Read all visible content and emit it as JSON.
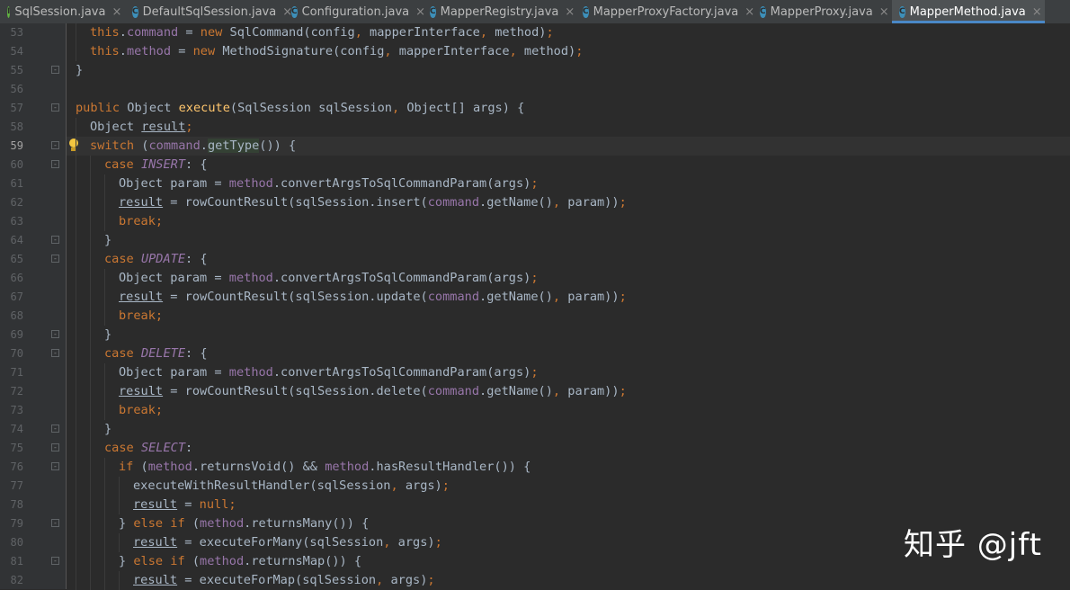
{
  "tabs": [
    {
      "name": "SqlSession.java",
      "icon": "I",
      "kind": "interface",
      "active": false
    },
    {
      "name": "DefaultSqlSession.java",
      "icon": "C",
      "kind": "class",
      "active": false
    },
    {
      "name": "Configuration.java",
      "icon": "C",
      "kind": "class",
      "active": false
    },
    {
      "name": "MapperRegistry.java",
      "icon": "C",
      "kind": "class",
      "active": false
    },
    {
      "name": "MapperProxyFactory.java",
      "icon": "C",
      "kind": "class",
      "active": false
    },
    {
      "name": "MapperProxy.java",
      "icon": "C",
      "kind": "class",
      "active": false
    },
    {
      "name": "MapperMethod.java",
      "icon": "C",
      "kind": "class",
      "active": true
    }
  ],
  "close_glyph": "×",
  "current_line": 59,
  "lines": [
    {
      "n": 53,
      "indent": 1,
      "tokens": [
        [
          "this",
          "kw"
        ],
        [
          ".",
          ""
        ],
        [
          "command",
          "fld"
        ],
        [
          " = ",
          ""
        ],
        [
          "new",
          "kw"
        ],
        [
          " SqlCommand(config",
          ""
        ],
        [
          ",",
          "kw"
        ],
        [
          " mapperInterface",
          ""
        ],
        [
          ",",
          "kw"
        ],
        [
          " method)",
          ""
        ],
        [
          ";",
          "kw"
        ]
      ]
    },
    {
      "n": 54,
      "indent": 1,
      "tokens": [
        [
          "this",
          "kw"
        ],
        [
          ".",
          ""
        ],
        [
          "method",
          "fld"
        ],
        [
          " = ",
          ""
        ],
        [
          "new",
          "kw"
        ],
        [
          " MethodSignature(config",
          ""
        ],
        [
          ",",
          "kw"
        ],
        [
          " mapperInterface",
          ""
        ],
        [
          ",",
          "kw"
        ],
        [
          " method)",
          ""
        ],
        [
          ";",
          "kw"
        ]
      ]
    },
    {
      "n": 55,
      "indent": 0,
      "fold": "-",
      "tokens": [
        [
          "}",
          ""
        ]
      ]
    },
    {
      "n": 56,
      "indent": 0,
      "tokens": []
    },
    {
      "n": 57,
      "indent": 0,
      "fold": "-",
      "tokens": [
        [
          "public",
          "kw"
        ],
        [
          " Object ",
          ""
        ],
        [
          "execute",
          "decl"
        ],
        [
          "(SqlSession sqlSession",
          ""
        ],
        [
          ",",
          "kw"
        ],
        [
          " Object[] args) {",
          ""
        ]
      ]
    },
    {
      "n": 58,
      "indent": 1,
      "tokens": [
        [
          "Object ",
          ""
        ],
        [
          "result",
          "under"
        ],
        [
          ";",
          "kw"
        ]
      ]
    },
    {
      "n": 59,
      "indent": 1,
      "fold": "-",
      "bulb": true,
      "tokens": [
        [
          "switch",
          "kw"
        ],
        [
          " (",
          ""
        ],
        [
          "command",
          "fld"
        ],
        [
          ".",
          ""
        ],
        [
          "getType",
          "hl"
        ],
        [
          "()) {",
          ""
        ]
      ]
    },
    {
      "n": 60,
      "indent": 2,
      "fold": "-",
      "tokens": [
        [
          "case",
          "kw"
        ],
        [
          " ",
          ""
        ],
        [
          "INSERT",
          "const"
        ],
        [
          ": {",
          ""
        ]
      ]
    },
    {
      "n": 61,
      "indent": 3,
      "tokens": [
        [
          "Object param = ",
          ""
        ],
        [
          "method",
          "fld"
        ],
        [
          ".convertArgsToSqlCommandParam(args)",
          ""
        ],
        [
          ";",
          "kw"
        ]
      ]
    },
    {
      "n": 62,
      "indent": 3,
      "tokens": [
        [
          "result",
          "under"
        ],
        [
          " = rowCountResult(sqlSession.insert(",
          ""
        ],
        [
          "command",
          "fld"
        ],
        [
          ".getName()",
          ""
        ],
        [
          ",",
          "kw"
        ],
        [
          " param))",
          ""
        ],
        [
          ";",
          "kw"
        ]
      ]
    },
    {
      "n": 63,
      "indent": 3,
      "tokens": [
        [
          "break",
          "kw"
        ],
        [
          ";",
          "kw"
        ]
      ]
    },
    {
      "n": 64,
      "indent": 2,
      "fold": "-",
      "tokens": [
        [
          "}",
          ""
        ]
      ]
    },
    {
      "n": 65,
      "indent": 2,
      "fold": "-",
      "tokens": [
        [
          "case",
          "kw"
        ],
        [
          " ",
          ""
        ],
        [
          "UPDATE",
          "const"
        ],
        [
          ": {",
          ""
        ]
      ]
    },
    {
      "n": 66,
      "indent": 3,
      "tokens": [
        [
          "Object param = ",
          ""
        ],
        [
          "method",
          "fld"
        ],
        [
          ".convertArgsToSqlCommandParam(args)",
          ""
        ],
        [
          ";",
          "kw"
        ]
      ]
    },
    {
      "n": 67,
      "indent": 3,
      "tokens": [
        [
          "result",
          "under"
        ],
        [
          " = rowCountResult(sqlSession.update(",
          ""
        ],
        [
          "command",
          "fld"
        ],
        [
          ".getName()",
          ""
        ],
        [
          ",",
          "kw"
        ],
        [
          " param))",
          ""
        ],
        [
          ";",
          "kw"
        ]
      ]
    },
    {
      "n": 68,
      "indent": 3,
      "tokens": [
        [
          "break",
          "kw"
        ],
        [
          ";",
          "kw"
        ]
      ]
    },
    {
      "n": 69,
      "indent": 2,
      "fold": "-",
      "tokens": [
        [
          "}",
          ""
        ]
      ]
    },
    {
      "n": 70,
      "indent": 2,
      "fold": "-",
      "tokens": [
        [
          "case",
          "kw"
        ],
        [
          " ",
          ""
        ],
        [
          "DELETE",
          "const"
        ],
        [
          ": {",
          ""
        ]
      ]
    },
    {
      "n": 71,
      "indent": 3,
      "tokens": [
        [
          "Object param = ",
          ""
        ],
        [
          "method",
          "fld"
        ],
        [
          ".convertArgsToSqlCommandParam(args)",
          ""
        ],
        [
          ";",
          "kw"
        ]
      ]
    },
    {
      "n": 72,
      "indent": 3,
      "tokens": [
        [
          "result",
          "under"
        ],
        [
          " = rowCountResult(sqlSession.delete(",
          ""
        ],
        [
          "command",
          "fld"
        ],
        [
          ".getName()",
          ""
        ],
        [
          ",",
          "kw"
        ],
        [
          " param))",
          ""
        ],
        [
          ";",
          "kw"
        ]
      ]
    },
    {
      "n": 73,
      "indent": 3,
      "tokens": [
        [
          "break",
          "kw"
        ],
        [
          ";",
          "kw"
        ]
      ]
    },
    {
      "n": 74,
      "indent": 2,
      "fold": "-",
      "tokens": [
        [
          "}",
          ""
        ]
      ]
    },
    {
      "n": 75,
      "indent": 2,
      "fold": "-",
      "tokens": [
        [
          "case",
          "kw"
        ],
        [
          " ",
          ""
        ],
        [
          "SELECT",
          "const"
        ],
        [
          ":",
          ""
        ]
      ]
    },
    {
      "n": 76,
      "indent": 3,
      "fold": "-",
      "tokens": [
        [
          "if",
          "kw"
        ],
        [
          " (",
          ""
        ],
        [
          "method",
          "fld"
        ],
        [
          ".returnsVoid() && ",
          ""
        ],
        [
          "method",
          "fld"
        ],
        [
          ".hasResultHandler()) {",
          ""
        ]
      ]
    },
    {
      "n": 77,
      "indent": 4,
      "tokens": [
        [
          "executeWithResultHandler(sqlSession",
          ""
        ],
        [
          ",",
          "kw"
        ],
        [
          " args)",
          ""
        ],
        [
          ";",
          "kw"
        ]
      ]
    },
    {
      "n": 78,
      "indent": 4,
      "tokens": [
        [
          "result",
          "under"
        ],
        [
          " = ",
          ""
        ],
        [
          "null",
          "kw"
        ],
        [
          ";",
          "kw"
        ]
      ]
    },
    {
      "n": 79,
      "indent": 3,
      "fold": "-",
      "tokens": [
        [
          "} ",
          ""
        ],
        [
          "else if",
          "kw"
        ],
        [
          " (",
          ""
        ],
        [
          "method",
          "fld"
        ],
        [
          ".returnsMany()) {",
          ""
        ]
      ]
    },
    {
      "n": 80,
      "indent": 4,
      "tokens": [
        [
          "result",
          "under"
        ],
        [
          " = executeForMany(sqlSession",
          ""
        ],
        [
          ",",
          "kw"
        ],
        [
          " args)",
          ""
        ],
        [
          ";",
          "kw"
        ]
      ]
    },
    {
      "n": 81,
      "indent": 3,
      "fold": "-",
      "tokens": [
        [
          "} ",
          ""
        ],
        [
          "else if",
          "kw"
        ],
        [
          " (",
          ""
        ],
        [
          "method",
          "fld"
        ],
        [
          ".returnsMap()) {",
          ""
        ]
      ]
    },
    {
      "n": 82,
      "indent": 4,
      "tokens": [
        [
          "result",
          "under"
        ],
        [
          " = executeForMap(sqlSession",
          ""
        ],
        [
          ",",
          "kw"
        ],
        [
          " args)",
          ""
        ],
        [
          ";",
          "kw"
        ]
      ]
    }
  ],
  "watermark": "知乎 @jft"
}
